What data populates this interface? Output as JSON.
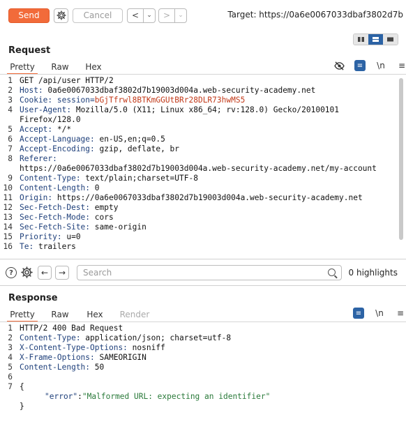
{
  "toolbar": {
    "send_label": "Send",
    "cancel_label": "Cancel",
    "back_glyph": "<",
    "back_menu_glyph": "⌄",
    "forward_glyph": ">",
    "forward_menu_glyph": "⌄",
    "target_text": "Target: https://0a6e0067033dbaf3802d7b"
  },
  "request": {
    "title": "Request",
    "tabs": [
      "Pretty",
      "Raw",
      "Hex"
    ],
    "wrap_tool": "≡",
    "newline_tool": "\\n",
    "menu_tool": "≡",
    "lines": [
      {
        "n": "1",
        "key": "",
        "val": "GET /api/user HTTP/2"
      },
      {
        "n": "2",
        "key": "Host:",
        "val": " 0a6e0067033dbaf3802d7b19003d004a.web-security-academy.net"
      },
      {
        "n": "3",
        "key": "Cookie: session=",
        "val": "bGjTfrwl8BTKmGGUtBRr28DLR73hwMS5",
        "cookie": true
      },
      {
        "n": "4",
        "key": "User-Agent:",
        "val": " Mozilla/5.0 (X11; Linux x86_64; rv:128.0) Gecko/20100101"
      },
      {
        "n": "",
        "key": "",
        "val": "Firefox/128.0"
      },
      {
        "n": "5",
        "key": "Accept:",
        "val": " */*"
      },
      {
        "n": "6",
        "key": "Accept-Language:",
        "val": " en-US,en;q=0.5"
      },
      {
        "n": "7",
        "key": "Accept-Encoding:",
        "val": " gzip, deflate, br"
      },
      {
        "n": "8",
        "key": "Referer:",
        "val": ""
      },
      {
        "n": "",
        "key": "",
        "val": "https://0a6e0067033dbaf3802d7b19003d004a.web-security-academy.net/my-account"
      },
      {
        "n": "9",
        "key": "Content-Type:",
        "val": " text/plain;charset=UTF-8"
      },
      {
        "n": "10",
        "key": "Content-Length:",
        "val": " 0"
      },
      {
        "n": "11",
        "key": "Origin:",
        "val": " https://0a6e0067033dbaf3802d7b19003d004a.web-security-academy.net"
      },
      {
        "n": "12",
        "key": "Sec-Fetch-Dest:",
        "val": " empty"
      },
      {
        "n": "13",
        "key": "Sec-Fetch-Mode:",
        "val": " cors"
      },
      {
        "n": "14",
        "key": "Sec-Fetch-Site:",
        "val": " same-origin"
      },
      {
        "n": "15",
        "key": "Priority:",
        "val": " u=0"
      },
      {
        "n": "16",
        "key": "Te:",
        "val": " trailers"
      }
    ]
  },
  "search": {
    "help_glyph": "?",
    "prev_glyph": "←",
    "next_glyph": "→",
    "placeholder": "Search",
    "highlights": "0 highlights"
  },
  "response": {
    "title": "Response",
    "tabs": [
      "Pretty",
      "Raw",
      "Hex",
      "Render"
    ],
    "wrap_tool": "≡",
    "newline_tool": "\\n",
    "menu_tool": "≡",
    "lines": [
      {
        "n": "1",
        "key": "",
        "val": "HTTP/2 400 Bad Request"
      },
      {
        "n": "2",
        "key": "Content-Type:",
        "val": " application/json; charset=utf-8"
      },
      {
        "n": "3",
        "key": "X-Content-Type-Options:",
        "val": " nosniff"
      },
      {
        "n": "4",
        "key": "X-Frame-Options:",
        "val": " SAMEORIGIN"
      },
      {
        "n": "5",
        "key": "Content-Length:",
        "val": " 50"
      },
      {
        "n": "6",
        "key": "",
        "val": ""
      },
      {
        "n": "7",
        "key": "",
        "val": "{"
      },
      {
        "n": "",
        "key": "",
        "val": "",
        "json_key": "\"error\"",
        "json_sep": ":",
        "json_val": "\"Malformed URL: expecting an identifier\""
      },
      {
        "n": "",
        "key": "",
        "val": "}"
      }
    ]
  },
  "colors": {
    "accent": "#f26b3a",
    "selected": "#2c63a5",
    "header_key": "#1e3f7a",
    "cookie_value": "#c23a1a",
    "json_value": "#2a7a3a"
  }
}
